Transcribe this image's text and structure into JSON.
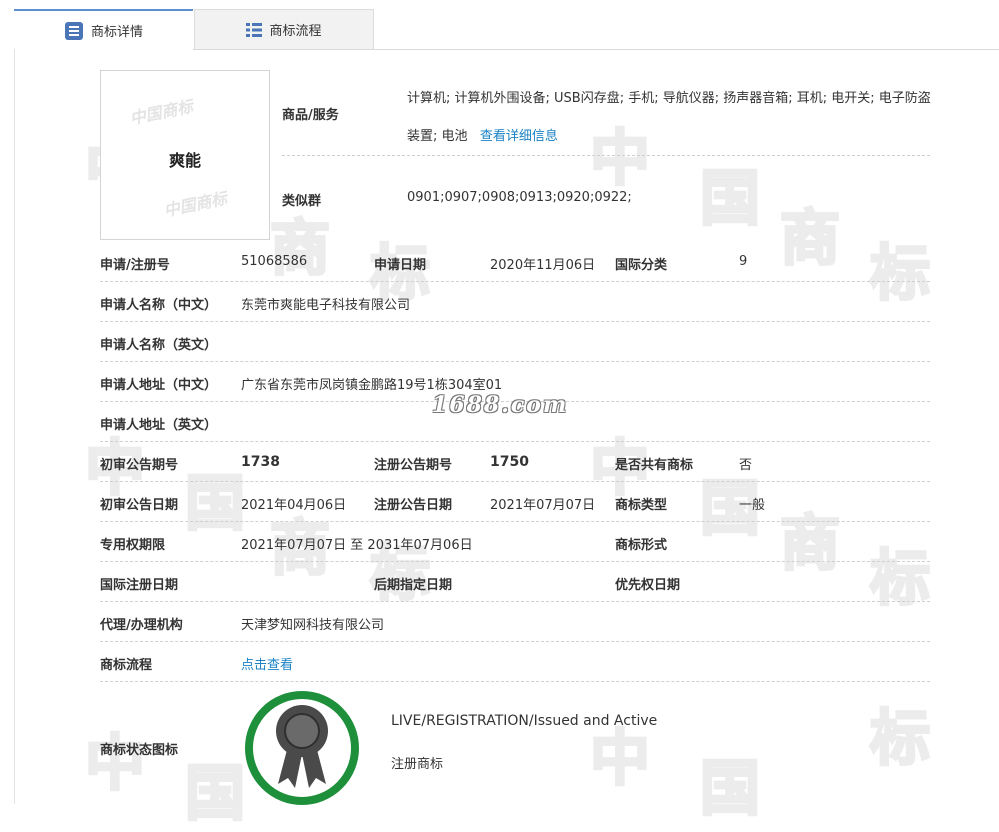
{
  "tabs": [
    {
      "label": "商标详情",
      "icon": "document-list-icon",
      "active": true
    },
    {
      "label": "商标流程",
      "icon": "list-icon",
      "active": false
    }
  ],
  "trademark": {
    "image_text": "爽能",
    "image_watermark": [
      "中国商标",
      "中国商标"
    ],
    "goods_label": "商品/服务",
    "goods_text": "计算机; 计算机外围设备; USB闪存盘; 手机; 导航仪器; 扬声器音箱; 耳机; 电开关; 电子防盗装置; 电池",
    "goods_link": "查看详细信息",
    "similar_label": "类似群",
    "similar_value": "0901;0907;0908;0913;0920;0922;"
  },
  "rows": {
    "app_no": {
      "label": "申请/注册号",
      "value": "51068586"
    },
    "app_date": {
      "label": "申请日期",
      "value": "2020年11月06日"
    },
    "intl_class": {
      "label": "国际分类",
      "value": "9"
    },
    "applicant_cn": {
      "label": "申请人名称（中文）",
      "value": "东莞市爽能电子科技有限公司"
    },
    "applicant_en": {
      "label": "申请人名称（英文）",
      "value": ""
    },
    "address_cn": {
      "label": "申请人地址（中文）",
      "value": "广东省东莞市凤岗镇金鹏路19号1栋304室01"
    },
    "address_en": {
      "label": "申请人地址（英文）",
      "value": ""
    },
    "prelim_no": {
      "label": "初审公告期号",
      "value": "1738"
    },
    "reg_no": {
      "label": "注册公告期号",
      "value": "1750"
    },
    "shared": {
      "label": "是否共有商标",
      "value": "否"
    },
    "prelim_date": {
      "label": "初审公告日期",
      "value": "2021年04月06日"
    },
    "reg_date": {
      "label": "注册公告日期",
      "value": "2021年07月07日"
    },
    "tm_type": {
      "label": "商标类型",
      "value": "一般"
    },
    "exclusive": {
      "label": "专用权期限",
      "value": "2021年07月07日 至 2031年07月06日"
    },
    "tm_form": {
      "label": "商标形式",
      "value": ""
    },
    "intl_reg_date": {
      "label": "国际注册日期",
      "value": ""
    },
    "later_date": {
      "label": "后期指定日期",
      "value": ""
    },
    "priority_date": {
      "label": "优先权日期",
      "value": ""
    },
    "agent": {
      "label": "代理/办理机构",
      "value": "天津梦知网科技有限公司"
    },
    "flow": {
      "label": "商标流程",
      "value": "点击查看"
    }
  },
  "status": {
    "label": "商标状态图标",
    "en": "LIVE/REGISTRATION/Issued and Active",
    "cn": "注册商标",
    "ring_color": "#1e8f3a",
    "badge_icon": "rosette-icon"
  },
  "site_watermark": "1688.com",
  "background_watermark": [
    "中",
    "国",
    "商",
    "标"
  ]
}
